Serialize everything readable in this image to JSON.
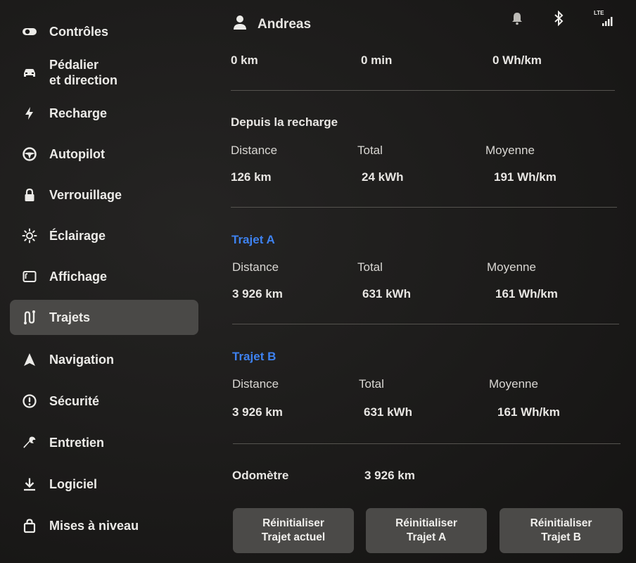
{
  "sidebar": {
    "items": [
      {
        "label": "Contrôles",
        "icon": "toggle-icon"
      },
      {
        "label": "Pédalier\net direction",
        "icon": "car-icon"
      },
      {
        "label": "Recharge",
        "icon": "lightning-icon"
      },
      {
        "label": "Autopilot",
        "icon": "steering-wheel-icon"
      },
      {
        "label": "Verrouillage",
        "icon": "lock-icon"
      },
      {
        "label": "Éclairage",
        "icon": "sun-icon"
      },
      {
        "label": "Affichage",
        "icon": "display-icon"
      },
      {
        "label": "Trajets",
        "icon": "trips-icon"
      },
      {
        "label": "Navigation",
        "icon": "navigation-icon"
      },
      {
        "label": "Sécurité",
        "icon": "alert-circle-icon"
      },
      {
        "label": "Entretien",
        "icon": "wrench-icon"
      },
      {
        "label": "Logiciel",
        "icon": "download-icon"
      },
      {
        "label": "Mises à niveau",
        "icon": "shopping-bag-icon"
      }
    ],
    "active": "Trajets"
  },
  "header": {
    "user_name": "Andreas",
    "network": "LTE"
  },
  "current_trip": {
    "distance": "0 km",
    "duration": "0 min",
    "average": "0 Wh/km"
  },
  "since_charge": {
    "title": "Depuis la recharge",
    "labels": {
      "distance": "Distance",
      "total": "Total",
      "average": "Moyenne"
    },
    "distance": "126 km",
    "total": "24 kWh",
    "average": "191 Wh/km"
  },
  "trip_a": {
    "title": "Trajet A",
    "labels": {
      "distance": "Distance",
      "total": "Total",
      "average": "Moyenne"
    },
    "distance": "3 926 km",
    "total": "631 kWh",
    "average": "161 Wh/km"
  },
  "trip_b": {
    "title": "Trajet B",
    "labels": {
      "distance": "Distance",
      "total": "Total",
      "average": "Moyenne"
    },
    "distance": "3 926 km",
    "total": "631 kWh",
    "average": "161 Wh/km"
  },
  "odometer": {
    "label": "Odomètre",
    "value": "3 926 km"
  },
  "buttons": {
    "reset_current": "Réinitialiser\nTrajet actuel",
    "reset_a": "Réinitialiser\nTrajet A",
    "reset_b": "Réinitialiser\nTrajet B"
  },
  "colors": {
    "accent_blue": "#3e82f0",
    "active_item_bg": "#4a4947",
    "button_bg": "#4b4a48"
  }
}
